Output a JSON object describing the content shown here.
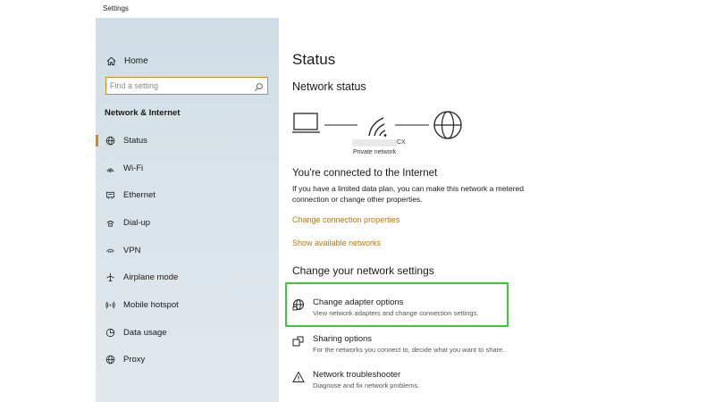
{
  "window": {
    "title": "Settings"
  },
  "sidebar": {
    "home_label": "Home",
    "search": {
      "placeholder": "Find a setting",
      "value": ""
    },
    "section_title": "Network & Internet",
    "items": [
      {
        "label": "Status",
        "icon": "globe-icon",
        "active": true
      },
      {
        "label": "Wi-Fi",
        "icon": "wifi-icon"
      },
      {
        "label": "Ethernet",
        "icon": "ethernet-icon"
      },
      {
        "label": "Dial-up",
        "icon": "dialup-icon"
      },
      {
        "label": "VPN",
        "icon": "vpn-icon"
      },
      {
        "label": "Airplane mode",
        "icon": "airplane-icon"
      },
      {
        "label": "Mobile hotspot",
        "icon": "hotspot-icon"
      },
      {
        "label": "Data usage",
        "icon": "data-usage-icon"
      },
      {
        "label": "Proxy",
        "icon": "proxy-globe-icon"
      }
    ]
  },
  "main": {
    "title": "Status",
    "network_status_heading": "Network status",
    "network": {
      "name_suffix": "CX",
      "type": "Private network"
    },
    "connected_heading": "You're connected to the Internet",
    "connected_desc": "If you have a limited data plan, you can make this network a metered connection or change other properties.",
    "links": {
      "change_properties": "Change connection properties",
      "show_networks": "Show available networks"
    },
    "change_settings_heading": "Change your network settings",
    "options": [
      {
        "title": "Change adapter options",
        "subtitle": "View network adapters and change connection settings.",
        "icon": "adapter-icon"
      },
      {
        "title": "Sharing options",
        "subtitle": "For the networks you connect to, decide what you want to share.",
        "icon": "sharing-icon"
      },
      {
        "title": "Network troubleshooter",
        "subtitle": "Diagnose and fix network problems.",
        "icon": "warning-icon"
      }
    ]
  },
  "colors": {
    "accent": "#d08a25",
    "link": "#b6771d",
    "highlight": "#3bc83b"
  }
}
